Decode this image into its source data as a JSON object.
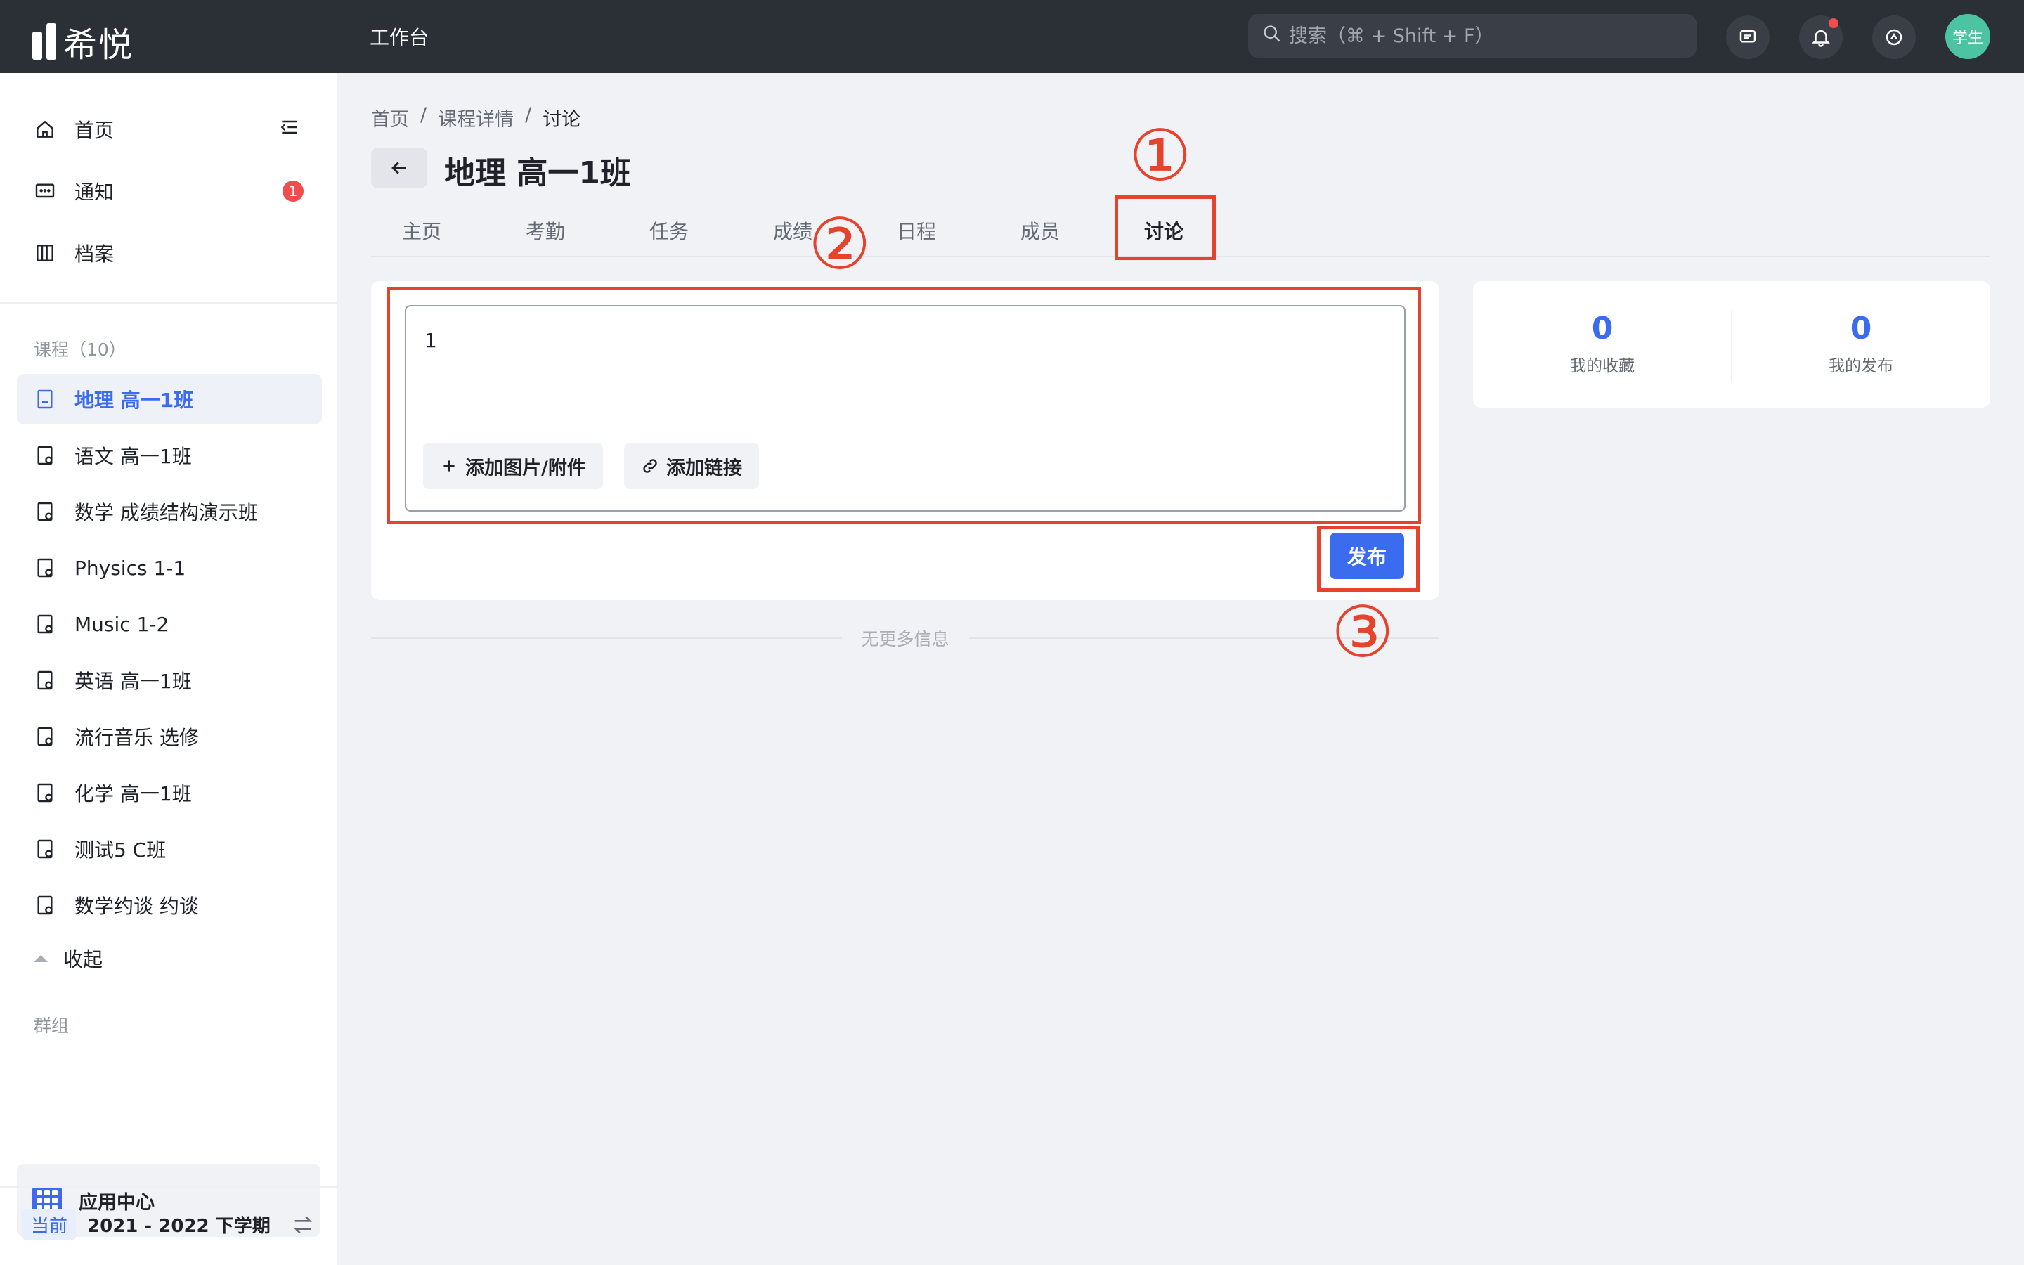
{
  "app": {
    "logo_text": "希悦",
    "workbench": "工作台",
    "avatar_text": "学生"
  },
  "search": {
    "placeholder": "搜索（⌘ + Shift + F）"
  },
  "sidebar": {
    "home": "首页",
    "notice": "通知",
    "notice_badge": "1",
    "archive": "档案",
    "courses_label": "课程（10）",
    "courses": [
      "地理 高一1班",
      "语文 高一1班",
      "数学 成绩结构演示班",
      "Physics 1-1",
      "Music 1-2",
      "英语 高一1班",
      "流行音乐 选修",
      "化学 高一1班",
      "测试5 C班",
      "数学约谈 约谈"
    ],
    "collapse": "收起",
    "groups_label": "群组",
    "app_center": "应用中心",
    "term_tag": "当前",
    "term": "2021 - 2022 下学期"
  },
  "breadcrumb": [
    "首页",
    "课程详情",
    "讨论"
  ],
  "page_title": "地理 高一1班",
  "tabs": [
    "主页",
    "考勤",
    "任务",
    "成绩",
    "日程",
    "成员",
    "讨论"
  ],
  "editor": {
    "value": "1",
    "add_attachment": "添加图片/附件",
    "add_link": "添加链接",
    "publish": "发布"
  },
  "no_more": "无更多信息",
  "stats": {
    "favorites_count": "0",
    "favorites_label": "我的收藏",
    "posts_count": "0",
    "posts_label": "我的发布"
  },
  "annotations": [
    "①",
    "②",
    "③"
  ],
  "colors": {
    "accent": "#3b6cf0",
    "annotation": "#e5432c",
    "topbar": "#2b2f36",
    "badge": "#f24c4c",
    "avatar": "#4cc3a1"
  }
}
